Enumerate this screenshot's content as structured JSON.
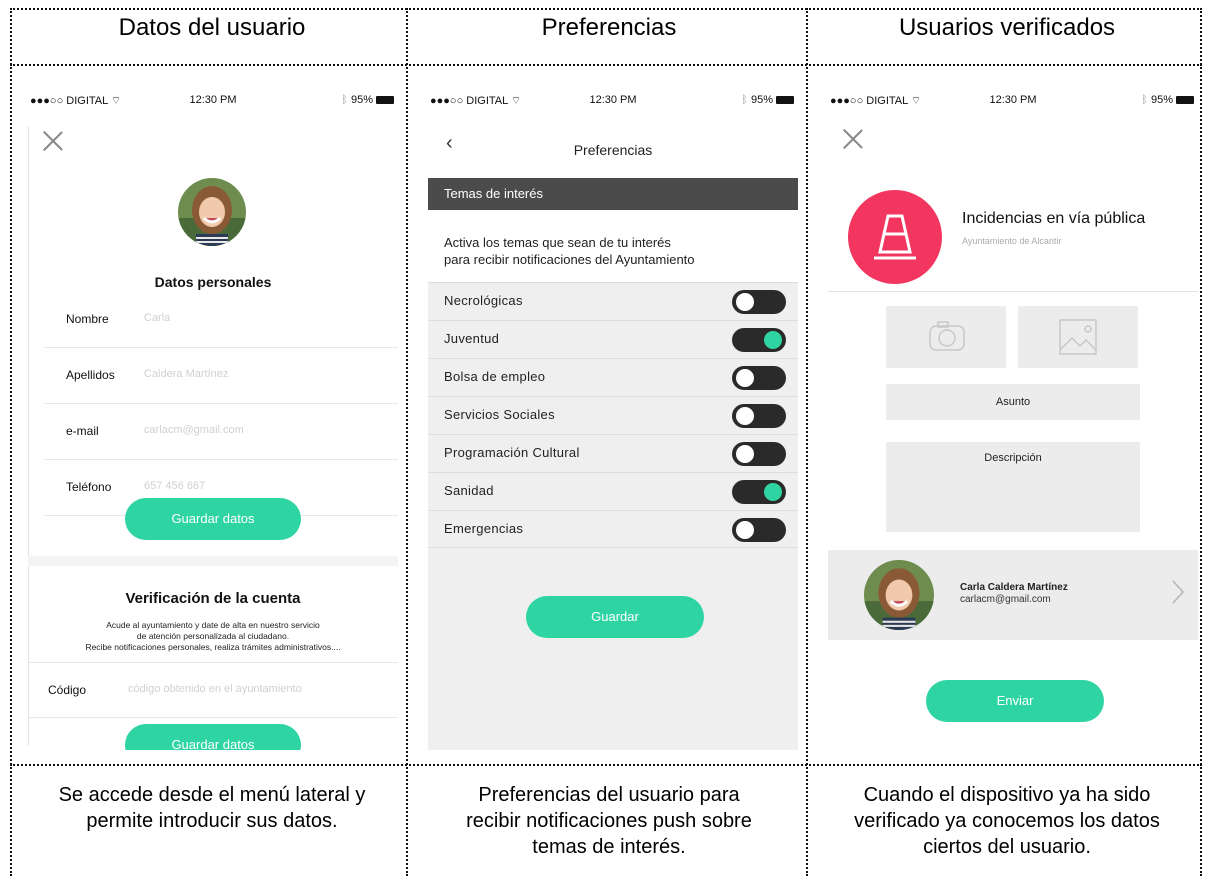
{
  "columns": [
    {
      "title": "Datos del usuario",
      "caption_line1": "Se accede desde el menú lateral y",
      "caption_line2": "permite introducir sus datos.",
      "caption_line3": ""
    },
    {
      "title": "Preferencias",
      "caption_line1": "Preferencias del usuario para",
      "caption_line2": "recibir notificaciones push sobre",
      "caption_line3": "temas de interés."
    },
    {
      "title": "Usuarios verificados",
      "caption_line1": "Cuando el dispositivo ya ha sido",
      "caption_line2": "verificado ya conocemos los datos",
      "caption_line3": "ciertos del usuario."
    }
  ],
  "status_bar": {
    "carrier": "●●●○○ DIGITAL",
    "time": "12:30 PM",
    "battery": "95%"
  },
  "user_screen": {
    "section_title": "Datos personales",
    "fields": [
      {
        "label": "Nombre",
        "value": "Carla"
      },
      {
        "label": "Apellidos",
        "value": "Caldera Martínez"
      },
      {
        "label": "e-mail",
        "value": "carlacm@gmail.com"
      },
      {
        "label": "Teléfono",
        "value": "657 456 667"
      }
    ],
    "save_label": "Guardar datos",
    "verification_title": "Verificación de la cuenta",
    "verification_line1": "Acude al ayuntamiento y date de alta en nuestro servicio",
    "verification_line2": "de atención personalizada al ciudadano.",
    "verification_line3": "Recibe notificaciones personales, realiza trámites administrativos....",
    "code_label": "Código",
    "code_placeholder": "código obtenido en el ayuntamiento",
    "save_label_2": "Guardar datos"
  },
  "preferences_screen": {
    "back": "‹",
    "title": "Preferencias",
    "section_header": "Temas de interés",
    "intro_line1": "Activa los temas que sean de tu interés",
    "intro_line2": "para recibir notificaciones del Ayuntamiento",
    "topics": [
      {
        "label": "Necrológicas",
        "on": false
      },
      {
        "label": "Juventud",
        "on": true
      },
      {
        "label": "Bolsa de empleo",
        "on": false
      },
      {
        "label": "Servicios Sociales",
        "on": false
      },
      {
        "label": "Programación Cultural",
        "on": false
      },
      {
        "label": "Sanidad",
        "on": true
      },
      {
        "label": "Emergencias",
        "on": false
      }
    ],
    "save_label": "Guardar"
  },
  "verified_screen": {
    "incident_title": "Incidencias en vía pública",
    "incident_subtitle": "Ayuntamiento de Alcantir",
    "subject_label": "Asunto",
    "description_label": "Descripción",
    "user_name": "Carla Caldera Martínez",
    "user_email": "carlacm@gmail.com",
    "send_label": "Enviar"
  },
  "colors": {
    "accent_green": "#2ed5a3",
    "incident_red": "#f2365f",
    "header_dark": "#4b4b4b"
  },
  "icons": [
    "close-icon",
    "back-chevron-icon",
    "traffic-cone-icon",
    "camera-icon",
    "image-icon",
    "chevron-right-icon",
    "wifi-icon",
    "bluetooth-icon",
    "battery-icon"
  ]
}
